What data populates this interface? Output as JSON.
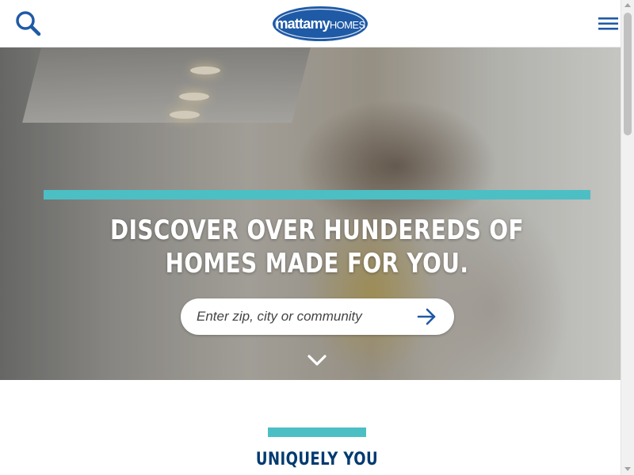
{
  "header": {
    "search_icon": "search-icon",
    "menu_icon": "hamburger-menu-icon",
    "logo": {
      "brand_main": "mattamy",
      "brand_sub": "HOMES",
      "color": "#1f5aa6"
    }
  },
  "hero": {
    "title": "DISCOVER OVER HUNDEREDS OF HOMES MADE FOR YOU.",
    "search": {
      "placeholder": "Enter zip, city or community",
      "value": ""
    },
    "submit_icon": "arrow-right-icon",
    "scroll_icon": "chevron-down-icon",
    "accent_color": "#4bbfc4"
  },
  "section": {
    "title": "UNIQUELY YOU",
    "title_color": "#003a70"
  },
  "colors": {
    "brand_blue": "#1f5aa6",
    "teal": "#4bbfc4",
    "navy": "#003a70"
  }
}
